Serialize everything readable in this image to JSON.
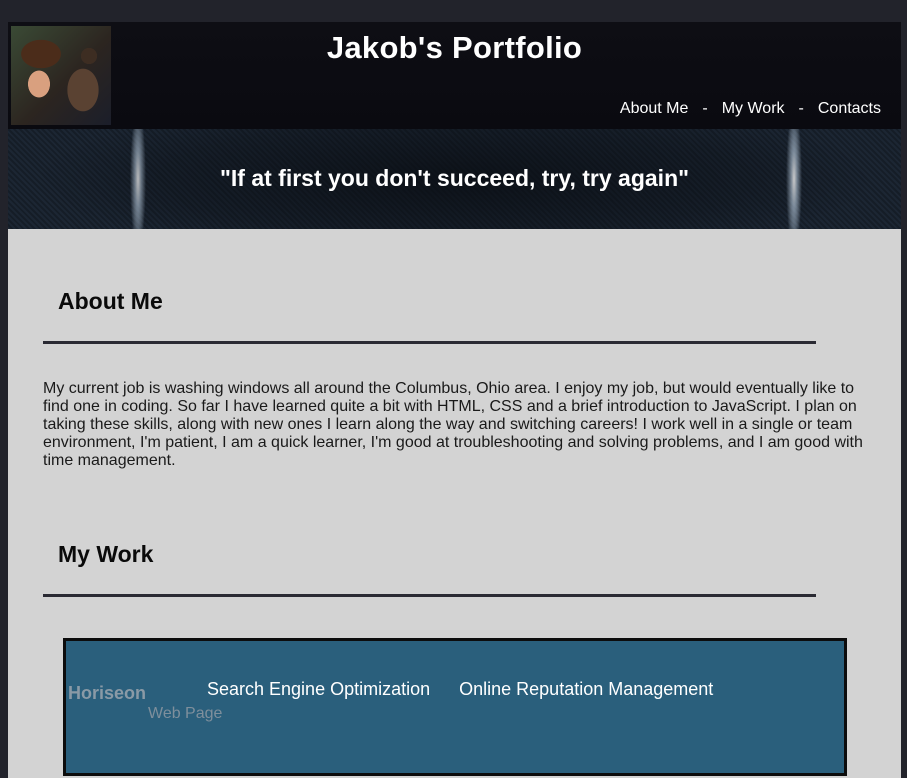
{
  "header": {
    "title": "Jakob's Portfolio",
    "nav": [
      "About Me",
      "My Work",
      "Contacts"
    ],
    "separator": "-"
  },
  "banner": {
    "quote": "\"If at first you don't succeed, try, try again\""
  },
  "about": {
    "heading": "About Me",
    "text": "My current job is washing windows all around the Columbus, Ohio area. I enjoy my job, but would eventually like to find one in coding. So far I have learned quite a bit with HTML, CSS and a brief introduction to JavaScript. I plan on taking these skills, along with new ones I learn along the way and switching careers! I work well in a single or team environment, I'm patient, I am a quick learner, I'm good at troubleshooting and solving problems, and I am good with time management."
  },
  "work": {
    "heading": "My Work",
    "card": {
      "brand": "Horiseon",
      "subtitle": "Web Page",
      "links": [
        "Search Engine Optimization",
        "Online Reputation Management"
      ]
    }
  },
  "colors": {
    "page_bg": "#22232b",
    "header_bg": "#0a0a10",
    "content_bg": "#d3d3d3",
    "card_bg": "#2a5f7c"
  }
}
